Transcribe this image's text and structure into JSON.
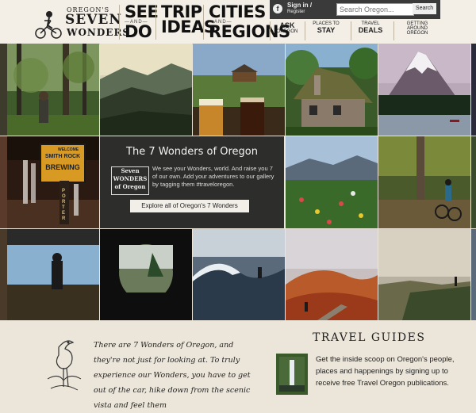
{
  "logo": {
    "line1": "OREGON'S",
    "line2": "SEVEN",
    "line3": "WONDERS"
  },
  "nav_big": [
    {
      "top": "SEE",
      "mid": "—AND—",
      "bottom": "DO"
    },
    {
      "top": "TRIP",
      "mid": "",
      "bottom": "IDEAS"
    },
    {
      "top": "CITIES",
      "mid": "—AND—",
      "bottom": "REGIONS"
    }
  ],
  "topbar": {
    "signin": "Sign in /",
    "register": "Register",
    "search_placeholder": "Search Oregon...",
    "search_button": "Search"
  },
  "nav_small": [
    {
      "top": "ASK",
      "bottom": "OREGON"
    },
    {
      "top": "PLACES TO",
      "bottom": "STAY"
    },
    {
      "top": "TRAVEL",
      "bottom": "DEALS"
    },
    {
      "top": "GETTING",
      "bottom": "AROUND OREGON"
    }
  ],
  "wonders": {
    "title": "The 7 Wonders of Oregon",
    "badge": [
      "Seven",
      "WONDERS",
      "of Oregon"
    ],
    "description": "We see your Wonders, world. And raise you 7 of our own. Add your adventures to our gallery by tagging them #traveloregon.",
    "button": "Explore all of Oregon's 7 Wonders"
  },
  "story": "There are 7 Wonders of Oregon, and they're not just for looking at. To truly experience our Wonders, you have to get out of the car, hike down from the scenic vista and feel them",
  "travel_guides": {
    "title": "TRAVEL GUIDES",
    "text": "Get the inside scoop on Oregon's people, places and happenings by signing up to receive free Travel Oregon publications."
  },
  "brewery_sign": {
    "line1": "WELCOME",
    "line2": "SMITH ROCK",
    "line3": "BREWING",
    "porter": "PORTER"
  },
  "icons": [
    "bike-logo-icon",
    "facebook-icon",
    "heron-icon"
  ],
  "colors": {
    "bg": "#ece6da",
    "header": "#f3efe7",
    "dark": "#2d2d2b"
  }
}
